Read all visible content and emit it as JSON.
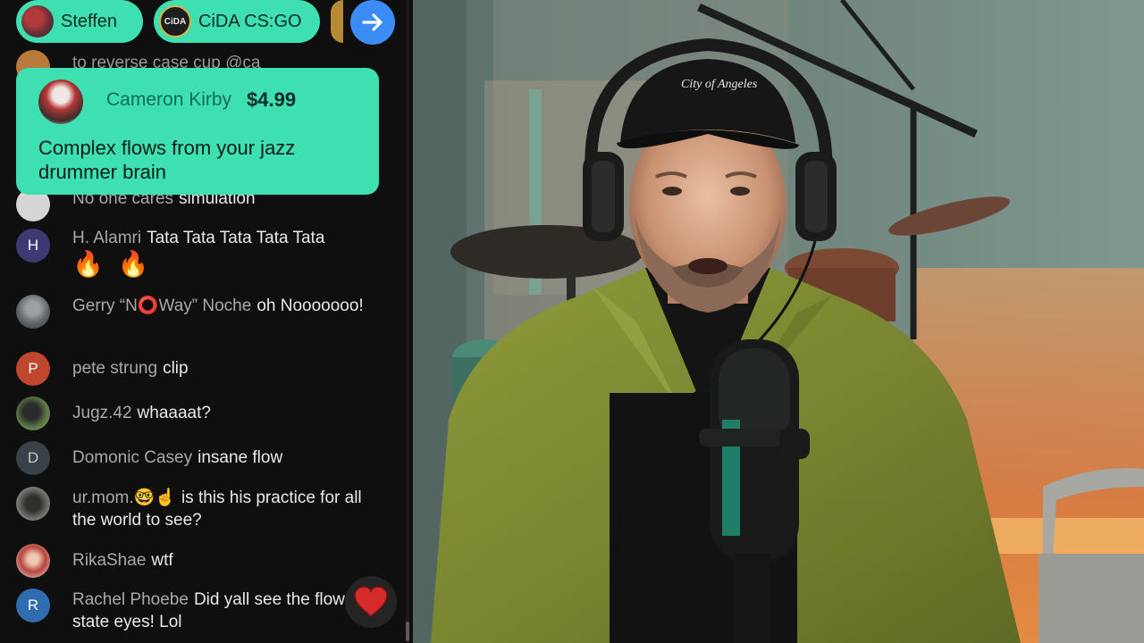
{
  "chips": [
    {
      "label": "Steffen"
    },
    {
      "label": "CiDA CS:GO",
      "avatar_text": "CiDA"
    }
  ],
  "superchat": {
    "name": "Cameron Kirby",
    "amount": "$4.99",
    "text": "Complex flows from your jazz drummer brain"
  },
  "chat": {
    "partial": "to reverse case cup @ca",
    "messages": [
      {
        "author": "No one cares",
        "text": "simulation",
        "avatar_letter": "",
        "avatar_color": "#d6d6d6"
      },
      {
        "author": "H. Alamri",
        "text": "Tata Tata Tata Tata Tata",
        "emoji": "🔥 🔥",
        "avatar_letter": "H",
        "avatar_color": "#3d3a73"
      },
      {
        "author": "Gerry “N⭕Way” Noche",
        "text": "oh Nooooooo!",
        "avatar_letter": "",
        "avatar_color": "#6b6f72"
      },
      {
        "author": "pete strung",
        "text": "clip",
        "avatar_letter": "P",
        "avatar_color": "#c0462d"
      },
      {
        "author": "Jugz.42",
        "text": "whaaaat?",
        "avatar_letter": "",
        "avatar_color": "#5e7a45"
      },
      {
        "author": "Domonic Casey",
        "text": "insane flow",
        "avatar_letter": "D",
        "avatar_color": "#3a4148"
      },
      {
        "author": "ur.mom.🤓☝️",
        "text": "is this his practice for all the world to see?",
        "avatar_letter": "",
        "avatar_color": "#6e6a66"
      },
      {
        "author": "RikaShae",
        "text": "wtf",
        "avatar_letter": "",
        "avatar_color": "#b8443e"
      },
      {
        "author": "Rachel Phoebe",
        "text": "Did yall see the flow state eyes! Lol",
        "avatar_letter": "R",
        "avatar_color": "#2f6db0"
      }
    ]
  },
  "video": {
    "hat_text": "City of Angeles"
  }
}
